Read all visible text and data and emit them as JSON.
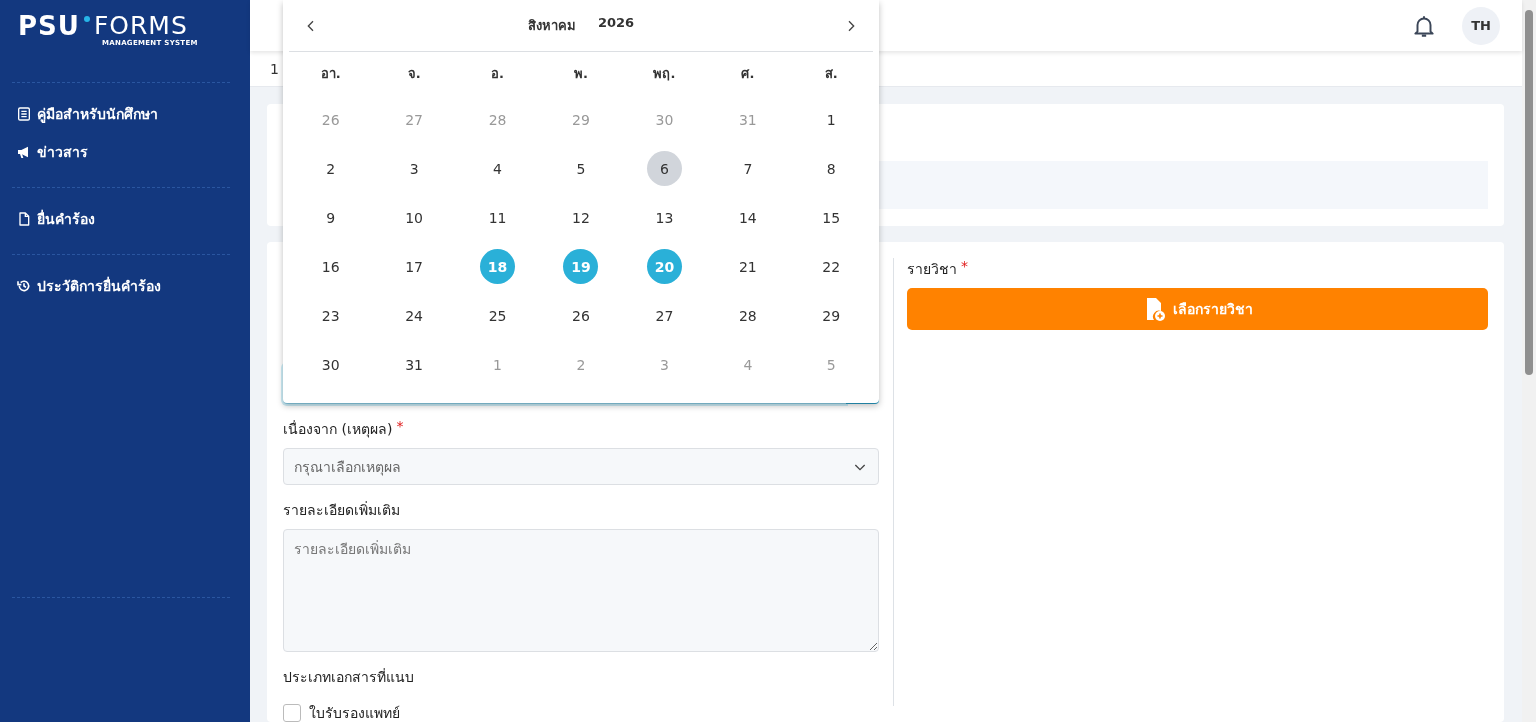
{
  "sidebar": {
    "logo": {
      "left": "PSU",
      "right": "FORMS",
      "sub": "MANAGEMENT SYSTEM"
    },
    "groups": [
      [
        {
          "label": "คู่มือสำหรับนักศึกษา"
        },
        {
          "label": "ข่าวสาร"
        }
      ],
      [
        {
          "label": "ยื่นคำร้อง"
        }
      ],
      [
        {
          "label": "ประวัติการยื่นคำร้อง"
        }
      ]
    ]
  },
  "header": {
    "avatar": "TH"
  },
  "breadcrumb": "1",
  "calendar": {
    "month": "สิงหาคม",
    "year": "2026",
    "weekdays": [
      "อา.",
      "จ.",
      "อ.",
      "พ.",
      "พฤ.",
      "ศ.",
      "ส."
    ],
    "days": [
      {
        "label": "26",
        "muted": true,
        "today": false,
        "selected": false
      },
      {
        "label": "27",
        "muted": true,
        "today": false,
        "selected": false
      },
      {
        "label": "28",
        "muted": true,
        "today": false,
        "selected": false
      },
      {
        "label": "29",
        "muted": true,
        "today": false,
        "selected": false
      },
      {
        "label": "30",
        "muted": true,
        "today": false,
        "selected": false
      },
      {
        "label": "31",
        "muted": true,
        "today": false,
        "selected": false
      },
      {
        "label": "1",
        "muted": false,
        "today": false,
        "selected": false
      },
      {
        "label": "2",
        "muted": false,
        "today": false,
        "selected": false
      },
      {
        "label": "3",
        "muted": false,
        "today": false,
        "selected": false
      },
      {
        "label": "4",
        "muted": false,
        "today": false,
        "selected": false
      },
      {
        "label": "5",
        "muted": false,
        "today": false,
        "selected": false
      },
      {
        "label": "6",
        "muted": false,
        "today": true,
        "selected": false
      },
      {
        "label": "7",
        "muted": false,
        "today": false,
        "selected": false
      },
      {
        "label": "8",
        "muted": false,
        "today": false,
        "selected": false
      },
      {
        "label": "9",
        "muted": false,
        "today": false,
        "selected": false
      },
      {
        "label": "10",
        "muted": false,
        "today": false,
        "selected": false
      },
      {
        "label": "11",
        "muted": false,
        "today": false,
        "selected": false
      },
      {
        "label": "12",
        "muted": false,
        "today": false,
        "selected": false
      },
      {
        "label": "13",
        "muted": false,
        "today": false,
        "selected": false
      },
      {
        "label": "14",
        "muted": false,
        "today": false,
        "selected": false
      },
      {
        "label": "15",
        "muted": false,
        "today": false,
        "selected": false
      },
      {
        "label": "16",
        "muted": false,
        "today": false,
        "selected": false
      },
      {
        "label": "17",
        "muted": false,
        "today": false,
        "selected": false
      },
      {
        "label": "18",
        "muted": false,
        "today": false,
        "selected": true
      },
      {
        "label": "19",
        "muted": false,
        "today": false,
        "selected": true
      },
      {
        "label": "20",
        "muted": false,
        "today": false,
        "selected": true
      },
      {
        "label": "21",
        "muted": false,
        "today": false,
        "selected": false
      },
      {
        "label": "22",
        "muted": false,
        "today": false,
        "selected": false
      },
      {
        "label": "23",
        "muted": false,
        "today": false,
        "selected": false
      },
      {
        "label": "24",
        "muted": false,
        "today": false,
        "selected": false
      },
      {
        "label": "25",
        "muted": false,
        "today": false,
        "selected": false
      },
      {
        "label": "26",
        "muted": false,
        "today": false,
        "selected": false
      },
      {
        "label": "27",
        "muted": false,
        "today": false,
        "selected": false
      },
      {
        "label": "28",
        "muted": false,
        "today": false,
        "selected": false
      },
      {
        "label": "29",
        "muted": false,
        "today": false,
        "selected": false
      },
      {
        "label": "30",
        "muted": false,
        "today": false,
        "selected": false
      },
      {
        "label": "31",
        "muted": false,
        "today": false,
        "selected": false
      },
      {
        "label": "1",
        "muted": true,
        "today": false,
        "selected": false
      },
      {
        "label": "2",
        "muted": true,
        "today": false,
        "selected": false
      },
      {
        "label": "3",
        "muted": true,
        "today": false,
        "selected": false
      },
      {
        "label": "4",
        "muted": true,
        "today": false,
        "selected": false
      },
      {
        "label": "5",
        "muted": true,
        "today": false,
        "selected": false
      }
    ]
  },
  "form": {
    "reason": {
      "label": "เนื่องจาก (เหตุผล)",
      "required_mark": "*",
      "placeholder": "กรุณาเลือกเหตุผล"
    },
    "details": {
      "label": "รายละเอียดเพิ่มเติม",
      "placeholder": "รายละเอียดเพิ่มเติม"
    },
    "attachments": {
      "label": "ประเภทเอกสารที่แนบ",
      "options": [
        {
          "label": "ใบรับรองแพทย์",
          "checked": false
        }
      ]
    },
    "courses": {
      "label": "รายวิชา",
      "required_mark": "*",
      "button": "เลือกรายวิชา"
    }
  }
}
